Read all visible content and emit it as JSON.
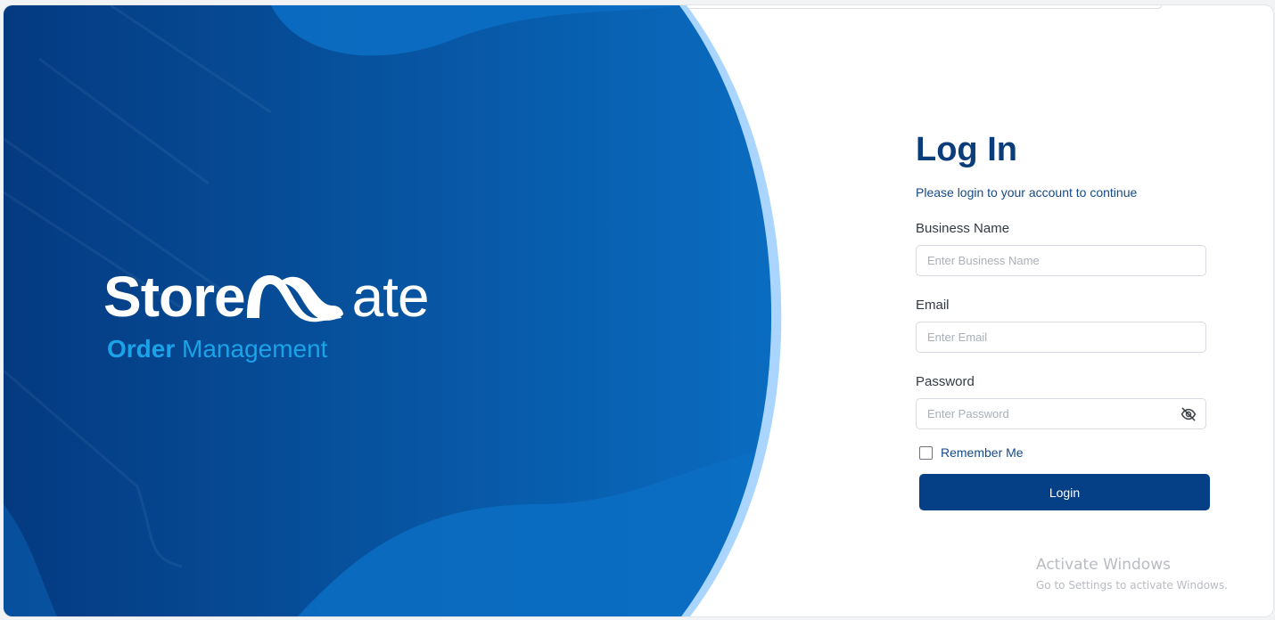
{
  "brand": {
    "name_bold": "Store",
    "name_light": "ate",
    "logo_mark": "stylized-m-mark",
    "subtitle_bold": "Order",
    "subtitle_rest": "Management"
  },
  "login": {
    "title": "Log In",
    "subtitle": "Please login to your account to continue",
    "business_label": "Business Name",
    "business_placeholder": "Enter Business Name",
    "business_value": "",
    "email_label": "Email",
    "email_placeholder": "Enter Email",
    "email_value": "",
    "password_label": "Password",
    "password_placeholder": "Enter Password",
    "password_value": "",
    "password_toggle_icon": "eye-off-icon",
    "remember_label": "Remember Me",
    "remember_checked": false,
    "button_label": "Login"
  },
  "watermark": {
    "title": "Activate Windows",
    "subtitle": "Go to Settings to activate Windows."
  },
  "colors": {
    "hero_dark": "#023f86",
    "hero_light": "#0a72c6",
    "hero_edge": "#a9d5ff",
    "accent_text": "#1aa3e8",
    "title": "#0b3d7a",
    "button": "#053f85"
  }
}
